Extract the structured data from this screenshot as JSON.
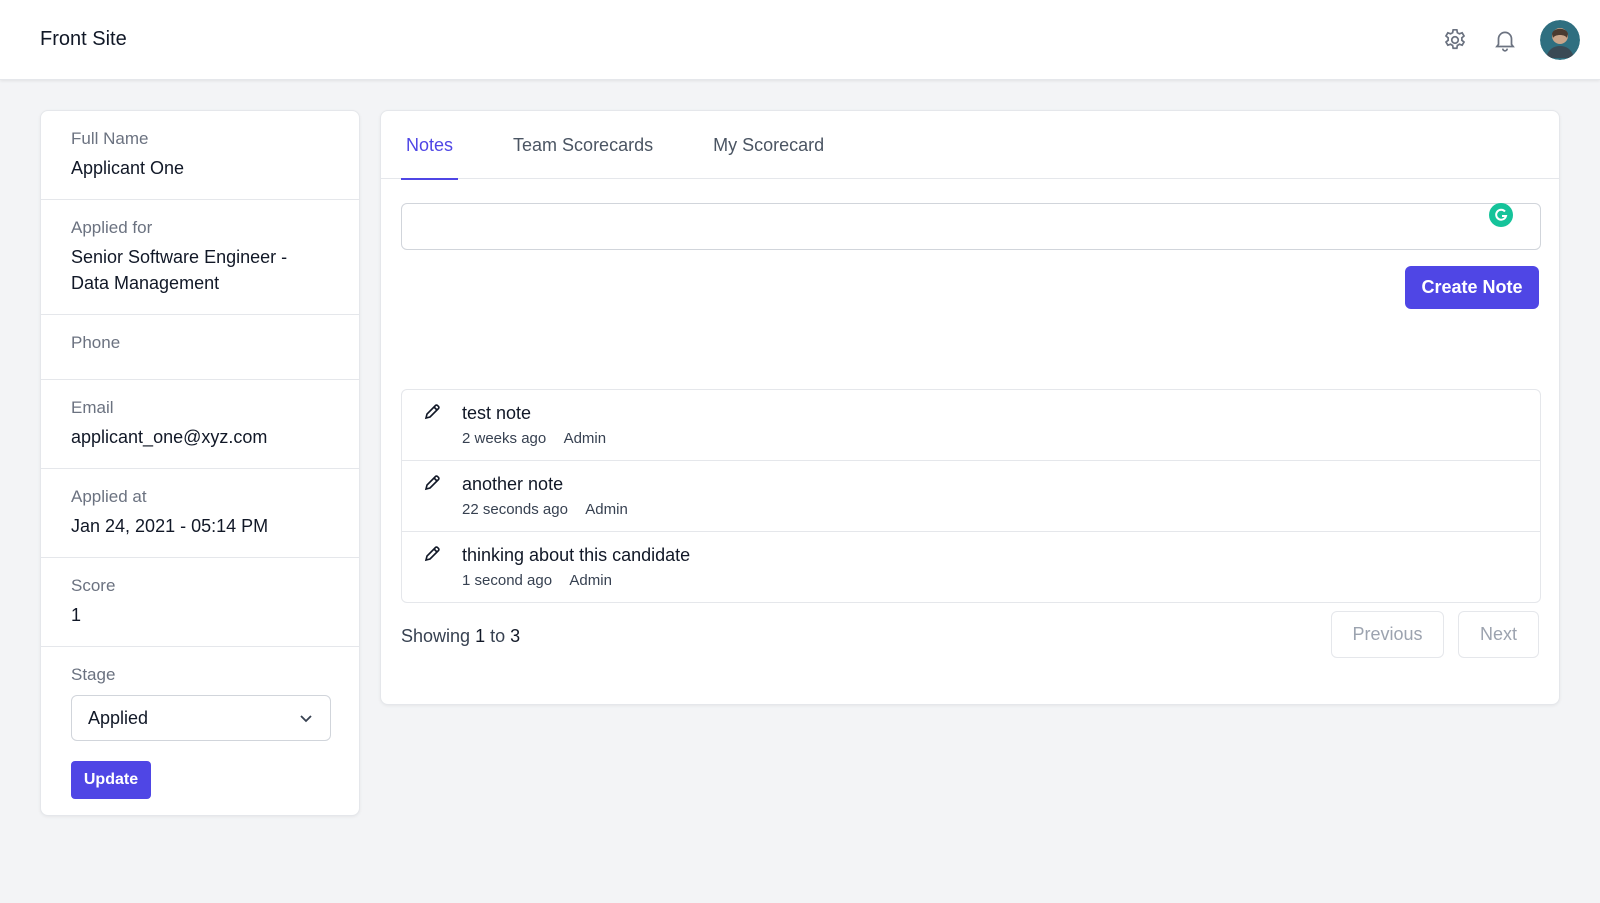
{
  "header": {
    "title": "Front Site",
    "settings_icon": "gear-icon",
    "notifications_icon": "bell-icon"
  },
  "applicant": {
    "full_name_label": "Full Name",
    "full_name": "Applicant One",
    "applied_for_label": "Applied for",
    "applied_for": "Senior Software Engineer - Data Management",
    "phone_label": "Phone",
    "phone": "",
    "email_label": "Email",
    "email": "applicant_one@xyz.com",
    "applied_at_label": "Applied at",
    "applied_at": "Jan 24, 2021 - 05:14 PM",
    "score_label": "Score",
    "score": "1",
    "stage_label": "Stage",
    "stage_value": "Applied",
    "update_label": "Update"
  },
  "tabs": [
    {
      "label": "Notes",
      "active": true
    },
    {
      "label": "Team Scorecards",
      "active": false
    },
    {
      "label": "My Scorecard",
      "active": false
    }
  ],
  "note_form": {
    "placeholder": "",
    "create_label": "Create Note"
  },
  "notes": [
    {
      "text": "test note",
      "time": "2 weeks ago",
      "author": "Admin"
    },
    {
      "text": "another note",
      "time": "22 seconds ago",
      "author": "Admin"
    },
    {
      "text": "thinking about this candidate",
      "time": "1 second ago",
      "author": "Admin"
    }
  ],
  "pagination": {
    "showing_prefix": "Showing",
    "from": "1",
    "to_word": "to",
    "to": "3",
    "previous_label": "Previous",
    "next_label": "Next"
  },
  "colors": {
    "accent": "#4f46e5",
    "grammarly": "#15c39a"
  }
}
